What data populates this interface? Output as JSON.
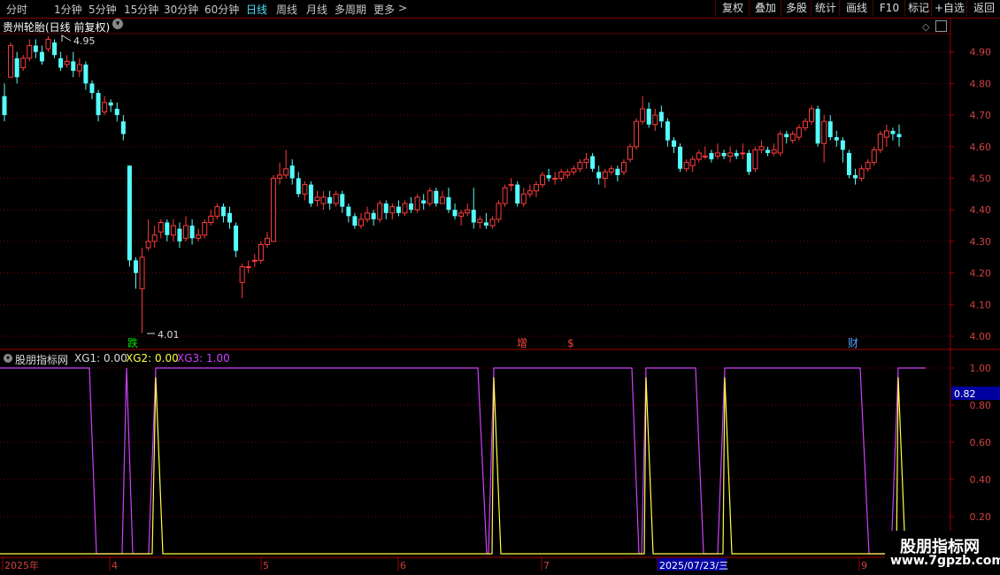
{
  "periods": [
    "分时",
    "1分钟",
    "5分钟",
    "15分钟",
    "30分钟",
    "60分钟",
    "日线",
    "周线",
    "月线",
    "多周期",
    "更多"
  ],
  "active_period": "日线",
  "more_arrow": ">",
  "toolbar": [
    "复权",
    "叠加",
    "多股",
    "统计",
    "画线",
    "F10",
    "+自选",
    "返回"
  ],
  "main_title": "贵州轮胎(日线 前复权)",
  "collapse_icon": "chevron-down-icon",
  "price_ticks": [
    "4.90",
    "4.80",
    "4.70",
    "4.60",
    "4.50",
    "4.40",
    "4.30",
    "4.20",
    "4.10",
    "4.00"
  ],
  "high_label": "4.95",
  "low_label": "4.01",
  "markers": [
    {
      "text": "跌",
      "color": "#00e000"
    },
    {
      "text": "增",
      "color": "#ff4040"
    },
    {
      "text": "$",
      "color": "#ff4040"
    },
    {
      "text": "财",
      "color": "#4fa0ff"
    }
  ],
  "indicator": {
    "name": "股朋指标网",
    "xg1": "XG1: 0.00",
    "xg2": "XG2: 0.00",
    "xg3": "XG3: 1.00",
    "ticks": [
      "1.00",
      "0.80",
      "0.60",
      "0.40",
      "0.20"
    ],
    "cursor_value": "0.82"
  },
  "date_axis": [
    "2025年",
    "4",
    "5",
    "6",
    "7",
    "2025/07/23/三",
    "9"
  ],
  "watermark_title": "股朋指标网",
  "watermark_url": "www.7gpzb.com",
  "colors": {
    "up": "#ff3c3c",
    "down": "#54ffff",
    "xg1": "#d040ff",
    "xg2": "#ffff40",
    "grid": "#800000"
  },
  "chart_data": {
    "type": "candlestick",
    "ylim": [
      4.0,
      4.95
    ],
    "candles": [
      [
        4.76,
        4.7,
        4.8,
        4.68
      ],
      [
        4.82,
        4.92,
        4.93,
        4.82
      ],
      [
        4.88,
        4.82,
        4.9,
        4.8
      ],
      [
        4.85,
        4.88,
        4.89,
        4.84
      ],
      [
        4.88,
        4.92,
        4.94,
        4.87
      ],
      [
        4.92,
        4.9,
        4.94,
        4.88
      ],
      [
        4.9,
        4.87,
        4.92,
        4.86
      ],
      [
        4.91,
        4.94,
        4.95,
        4.9
      ],
      [
        4.93,
        4.89,
        4.94,
        4.88
      ],
      [
        4.88,
        4.85,
        4.9,
        4.84
      ],
      [
        4.86,
        4.87,
        4.89,
        4.85
      ],
      [
        4.87,
        4.84,
        4.9,
        4.82
      ],
      [
        4.84,
        4.86,
        4.88,
        4.82
      ],
      [
        4.86,
        4.8,
        4.87,
        4.78
      ],
      [
        4.8,
        4.77,
        4.81,
        4.75
      ],
      [
        4.77,
        4.7,
        4.78,
        4.68
      ],
      [
        4.71,
        4.74,
        4.76,
        4.7
      ],
      [
        4.74,
        4.73,
        4.75,
        4.71
      ],
      [
        4.72,
        4.7,
        4.74,
        4.68
      ],
      [
        4.68,
        4.64,
        4.7,
        4.62
      ],
      [
        4.54,
        4.24,
        4.54,
        4.22
      ],
      [
        4.24,
        4.2,
        4.25,
        4.15
      ],
      [
        4.15,
        4.25,
        4.28,
        4.01
      ],
      [
        4.28,
        4.3,
        4.37,
        4.27
      ],
      [
        4.3,
        4.32,
        4.35,
        4.28
      ],
      [
        4.33,
        4.36,
        4.37,
        4.31
      ],
      [
        4.36,
        4.32,
        4.37,
        4.3
      ],
      [
        4.32,
        4.35,
        4.37,
        4.3
      ],
      [
        4.34,
        4.3,
        4.36,
        4.28
      ],
      [
        4.31,
        4.35,
        4.38,
        4.3
      ],
      [
        4.35,
        4.31,
        4.37,
        4.29
      ],
      [
        4.31,
        4.32,
        4.34,
        4.3
      ],
      [
        4.32,
        4.36,
        4.37,
        4.31
      ],
      [
        4.36,
        4.38,
        4.4,
        4.35
      ],
      [
        4.38,
        4.41,
        4.42,
        4.37
      ],
      [
        4.41,
        4.38,
        4.42,
        4.36
      ],
      [
        4.39,
        4.36,
        4.41,
        4.34
      ],
      [
        4.35,
        4.27,
        4.36,
        4.25
      ],
      [
        4.17,
        4.22,
        4.23,
        4.12
      ],
      [
        4.22,
        4.22,
        4.24,
        4.2
      ],
      [
        4.24,
        4.24,
        4.26,
        4.22
      ],
      [
        4.24,
        4.29,
        4.3,
        4.23
      ],
      [
        4.29,
        4.31,
        4.33,
        4.28
      ],
      [
        4.3,
        4.5,
        4.51,
        4.3
      ],
      [
        4.5,
        4.51,
        4.55,
        4.48
      ],
      [
        4.51,
        4.53,
        4.59,
        4.5
      ],
      [
        4.54,
        4.5,
        4.56,
        4.48
      ],
      [
        4.5,
        4.45,
        4.52,
        4.44
      ],
      [
        4.45,
        4.48,
        4.49,
        4.43
      ],
      [
        4.48,
        4.42,
        4.49,
        4.41
      ],
      [
        4.43,
        4.44,
        4.46,
        4.41
      ],
      [
        4.42,
        4.44,
        4.46,
        4.4
      ],
      [
        4.44,
        4.42,
        4.46,
        4.4
      ],
      [
        4.42,
        4.45,
        4.46,
        4.41
      ],
      [
        4.45,
        4.41,
        4.46,
        4.39
      ],
      [
        4.41,
        4.38,
        4.42,
        4.36
      ],
      [
        4.38,
        4.35,
        4.39,
        4.34
      ],
      [
        4.35,
        4.37,
        4.39,
        4.34
      ],
      [
        4.37,
        4.39,
        4.41,
        4.36
      ],
      [
        4.39,
        4.37,
        4.4,
        4.35
      ],
      [
        4.37,
        4.42,
        4.43,
        4.36
      ],
      [
        4.42,
        4.39,
        4.43,
        4.37
      ],
      [
        4.39,
        4.41,
        4.42,
        4.37
      ],
      [
        4.41,
        4.39,
        4.43,
        4.38
      ],
      [
        4.39,
        4.42,
        4.43,
        4.38
      ],
      [
        4.42,
        4.4,
        4.44,
        4.39
      ],
      [
        4.4,
        4.44,
        4.45,
        4.39
      ],
      [
        4.43,
        4.42,
        4.45,
        4.4
      ],
      [
        4.42,
        4.46,
        4.47,
        4.41
      ],
      [
        4.46,
        4.42,
        4.47,
        4.41
      ],
      [
        4.42,
        4.44,
        4.46,
        4.42
      ],
      [
        4.44,
        4.4,
        4.47,
        4.39
      ],
      [
        4.4,
        4.38,
        4.42,
        4.37
      ],
      [
        4.38,
        4.39,
        4.4,
        4.35
      ],
      [
        4.39,
        4.4,
        4.42,
        4.38
      ],
      [
        4.4,
        4.36,
        4.47,
        4.34
      ],
      [
        4.36,
        4.37,
        4.38,
        4.34
      ],
      [
        4.36,
        4.35,
        4.39,
        4.34
      ],
      [
        4.35,
        4.37,
        4.38,
        4.34
      ],
      [
        4.37,
        4.42,
        4.43,
        4.36
      ],
      [
        4.42,
        4.47,
        4.48,
        4.41
      ],
      [
        4.48,
        4.48,
        4.5,
        4.46
      ],
      [
        4.48,
        4.42,
        4.49,
        4.41
      ],
      [
        4.42,
        4.45,
        4.47,
        4.41
      ],
      [
        4.45,
        4.46,
        4.48,
        4.44
      ],
      [
        4.46,
        4.48,
        4.49,
        4.44
      ],
      [
        4.48,
        4.51,
        4.52,
        4.47
      ],
      [
        4.51,
        4.5,
        4.53,
        4.49
      ],
      [
        4.5,
        4.5,
        4.52,
        4.48
      ],
      [
        4.5,
        4.52,
        4.53,
        4.49
      ],
      [
        4.51,
        4.52,
        4.53,
        4.5
      ],
      [
        4.52,
        4.53,
        4.54,
        4.51
      ],
      [
        4.53,
        4.55,
        4.56,
        4.52
      ],
      [
        4.55,
        4.56,
        4.58,
        4.53
      ],
      [
        4.57,
        4.53,
        4.58,
        4.52
      ],
      [
        4.52,
        4.5,
        4.54,
        4.48
      ],
      [
        4.5,
        4.52,
        4.53,
        4.47
      ],
      [
        4.52,
        4.53,
        4.54,
        4.51
      ],
      [
        4.53,
        4.51,
        4.54,
        4.49
      ],
      [
        4.52,
        4.55,
        4.56,
        4.51
      ],
      [
        4.56,
        4.6,
        4.61,
        4.55
      ],
      [
        4.6,
        4.68,
        4.69,
        4.59
      ],
      [
        4.68,
        4.72,
        4.76,
        4.67
      ],
      [
        4.72,
        4.67,
        4.74,
        4.66
      ],
      [
        4.67,
        4.7,
        4.72,
        4.65
      ],
      [
        4.71,
        4.68,
        4.73,
        4.66
      ],
      [
        4.68,
        4.62,
        4.69,
        4.6
      ],
      [
        4.62,
        4.6,
        4.63,
        4.58
      ],
      [
        4.6,
        4.53,
        4.61,
        4.52
      ],
      [
        4.53,
        4.55,
        4.56,
        4.52
      ],
      [
        4.54,
        4.56,
        4.57,
        4.52
      ],
      [
        4.56,
        4.58,
        4.59,
        4.55
      ],
      [
        4.57,
        4.57,
        4.6,
        4.56
      ],
      [
        4.58,
        4.56,
        4.59,
        4.55
      ],
      [
        4.57,
        4.58,
        4.61,
        4.56
      ],
      [
        4.58,
        4.57,
        4.59,
        4.56
      ],
      [
        4.57,
        4.58,
        4.6,
        4.55
      ],
      [
        4.58,
        4.57,
        4.59,
        4.56
      ],
      [
        4.58,
        4.58,
        4.61,
        4.56
      ],
      [
        4.58,
        4.52,
        4.59,
        4.51
      ],
      [
        4.53,
        4.59,
        4.6,
        4.52
      ],
      [
        4.59,
        4.6,
        4.62,
        4.58
      ],
      [
        4.59,
        4.58,
        4.6,
        4.57
      ],
      [
        4.58,
        4.59,
        4.61,
        4.57
      ],
      [
        4.58,
        4.64,
        4.65,
        4.57
      ],
      [
        4.64,
        4.63,
        4.65,
        4.61
      ],
      [
        4.62,
        4.64,
        4.65,
        4.61
      ],
      [
        4.63,
        4.66,
        4.67,
        4.62
      ],
      [
        4.66,
        4.68,
        4.69,
        4.65
      ],
      [
        4.68,
        4.72,
        4.73,
        4.67
      ],
      [
        4.72,
        4.61,
        4.73,
        4.6
      ],
      [
        4.61,
        4.68,
        4.7,
        4.55
      ],
      [
        4.68,
        4.63,
        4.7,
        4.62
      ],
      [
        4.63,
        4.62,
        4.65,
        4.6
      ],
      [
        4.62,
        4.59,
        4.63,
        4.55
      ],
      [
        4.58,
        4.51,
        4.59,
        4.5
      ],
      [
        4.51,
        4.5,
        4.53,
        4.48
      ],
      [
        4.5,
        4.53,
        4.54,
        4.49
      ],
      [
        4.53,
        4.55,
        4.56,
        4.52
      ],
      [
        4.55,
        4.59,
        4.6,
        4.54
      ],
      [
        4.59,
        4.64,
        4.65,
        4.58
      ],
      [
        4.63,
        4.65,
        4.67,
        4.6
      ],
      [
        4.65,
        4.64,
        4.66,
        4.62
      ],
      [
        4.64,
        4.63,
        4.67,
        4.6
      ]
    ],
    "indicator_series": [
      {
        "name": "XG1",
        "color": "#d040ff",
        "points": [
          [
            0,
            1
          ],
          [
            101,
            1
          ],
          [
            109,
            0
          ],
          [
            138,
            0
          ],
          [
            143,
            1
          ],
          [
            150,
            0
          ],
          [
            168,
            0
          ],
          [
            176,
            1
          ],
          [
            540,
            1
          ],
          [
            550,
            0
          ],
          [
            552,
            0
          ],
          [
            558,
            1
          ],
          [
            714,
            1
          ],
          [
            722,
            0
          ],
          [
            725,
            0
          ],
          [
            730,
            1
          ],
          [
            786,
            1
          ],
          [
            795,
            0
          ],
          [
            811,
            0
          ],
          [
            819,
            1
          ],
          [
            972,
            1
          ],
          [
            982,
            0
          ],
          [
            1007,
            0
          ],
          [
            1015,
            1
          ],
          [
            1046,
            1
          ]
        ]
      },
      {
        "name": "XG2",
        "color": "#ffff40",
        "points": [
          [
            0,
            0
          ],
          [
            172,
            0
          ],
          [
            176,
            0.95
          ],
          [
            184,
            0
          ],
          [
            556,
            0
          ],
          [
            558,
            0.95
          ],
          [
            566,
            0
          ],
          [
            728,
            0
          ],
          [
            730,
            0.95
          ],
          [
            738,
            0
          ],
          [
            817,
            0
          ],
          [
            819,
            0.95
          ],
          [
            827,
            0
          ],
          [
            1013,
            0
          ],
          [
            1015,
            0.95
          ],
          [
            1023,
            0
          ],
          [
            1046,
            0
          ]
        ]
      }
    ]
  }
}
